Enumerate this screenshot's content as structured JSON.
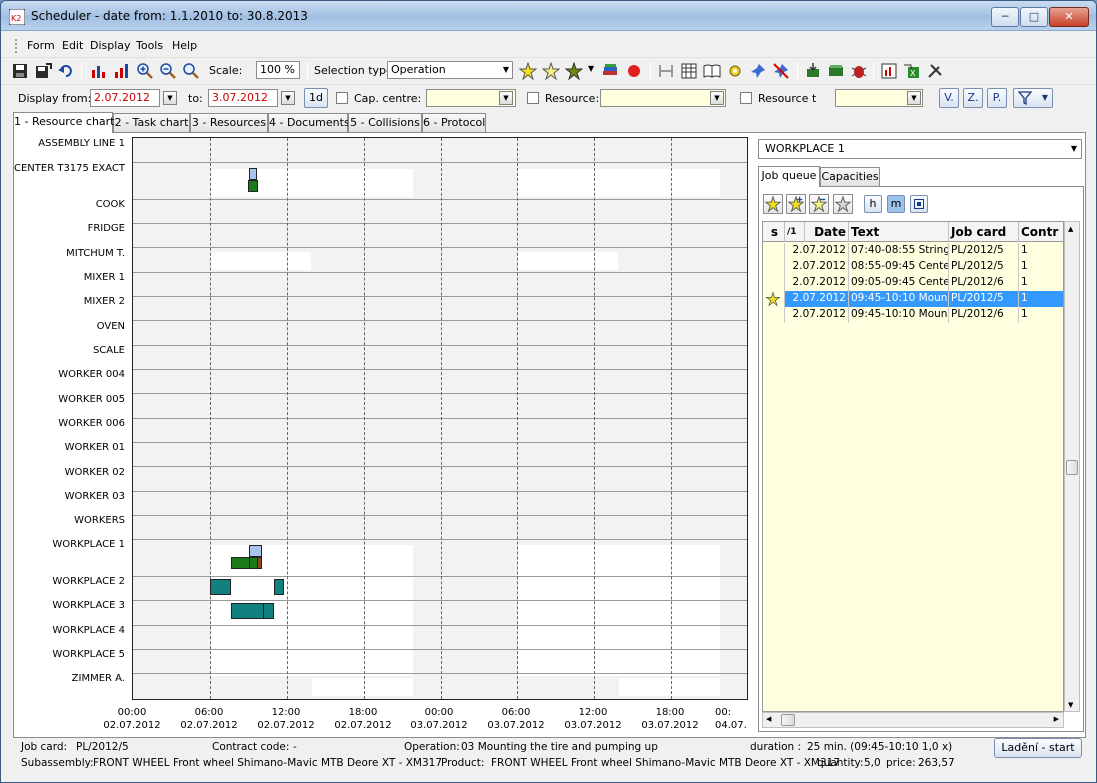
{
  "window": {
    "title": "Scheduler - date from: 1.1.2010 to: 30.8.2013"
  },
  "menu": [
    "Form",
    "Edit",
    "Display",
    "Tools",
    "Help"
  ],
  "toolbar": {
    "scale_label": "Scale:",
    "scale_value": "100 %",
    "selection_type_label": "Selection type:",
    "selection_type_value": "Operation"
  },
  "filter": {
    "display_from_label": "Display from:",
    "date_from": "2.07.2012",
    "to_label": "to:",
    "date_to": "3.07.2012",
    "period_button": "1d",
    "cap_centre_label": "Cap. centre:",
    "resource_label": "Resource:",
    "resource_t_label": "Resource t",
    "btn_v": "V.",
    "btn_z": "Z.",
    "btn_p": "P."
  },
  "tabs": [
    "1 - Resource chart",
    "2 - Task chart",
    "3 - Resources",
    "4 - Documents",
    "5 - Collisions",
    "6 - Protocol"
  ],
  "resources": [
    "ASSEMBLY LINE 1",
    "CENTER T3175 EXACT",
    "COOK",
    "FRIDGE",
    "MITCHUM T.",
    "MIXER 1",
    "MIXER 2",
    "OVEN",
    "SCALE",
    "WORKER 004",
    "WORKER 005",
    "WORKER 006",
    "WORKER 01",
    "WORKER 02",
    "WORKER 03",
    "WORKERS",
    "WORKPLACE 1",
    "WORKPLACE 2",
    "WORKPLACE 3",
    "WORKPLACE 4",
    "WORKPLACE 5",
    "ZIMMER A."
  ],
  "axis": {
    "times": [
      "00:00",
      "06:00",
      "12:00",
      "18:00",
      "00:00",
      "06:00",
      "12:00",
      "18:00",
      "00:"
    ],
    "dates": [
      "02.07.2012",
      "02.07.2012",
      "02.07.2012",
      "02.07.2012",
      "03.07.2012",
      "03.07.2012",
      "03.07.2012",
      "03.07.2012",
      "04.07."
    ]
  },
  "colors": {
    "task_green": "#1a7a1a",
    "task_teal": "#138080",
    "task_blue": "#a7c4ec",
    "task_brown": "#8a4a1a",
    "selection": "#3399ff",
    "queue_bg": "#ffffe0"
  },
  "side": {
    "workplace": "WORKPLACE 1",
    "subtabs": [
      "Job queue",
      "Capacities"
    ],
    "toggle_h": "h",
    "toggle_m": "m",
    "columns": [
      "s",
      "/1",
      "Date",
      "Text",
      "Job card",
      "Contr"
    ],
    "rows": [
      {
        "date": "2.07.2012",
        "text": "07:40-08:55 String...",
        "job": "PL/2012/5",
        "contr": "1"
      },
      {
        "date": "2.07.2012",
        "text": "08:55-09:45 Cente...",
        "job": "PL/2012/5",
        "contr": "1"
      },
      {
        "date": "2.07.2012",
        "text": "09:05-09:45 Cente...",
        "job": "PL/2012/6",
        "contr": "1"
      },
      {
        "date": "2.07.2012",
        "text": "09:45-10:10 Moun...",
        "job": "PL/2012/5",
        "contr": "1"
      },
      {
        "date": "2.07.2012",
        "text": "09:45-10:10 Moun...",
        "job": "PL/2012/6",
        "contr": "1"
      }
    ]
  },
  "status": {
    "job_card_label": "Job card:",
    "job_card": "PL/2012/5",
    "contract_label": "Contract code:",
    "contract": "-",
    "operation_label": "Operation:",
    "operation": "03 Mounting the tire and pumping up",
    "duration_label": "duration :",
    "duration": "25 min.  (09:45-10:10 1,0 x)",
    "debug_button": "Ladění - start",
    "subassembly_label": "Subassembly:",
    "subassembly": "FRONT WHEEL  Front wheel Shimano-Mavic MTB Deore XT - XM317",
    "product_label": "Product:",
    "product": "FRONT WHEEL  Front wheel Shimano-Mavic MTB Deore XT - XM317",
    "quantity_label": "quantity:",
    "quantity": "5,0",
    "price_label": "price:",
    "price": "263,57"
  }
}
